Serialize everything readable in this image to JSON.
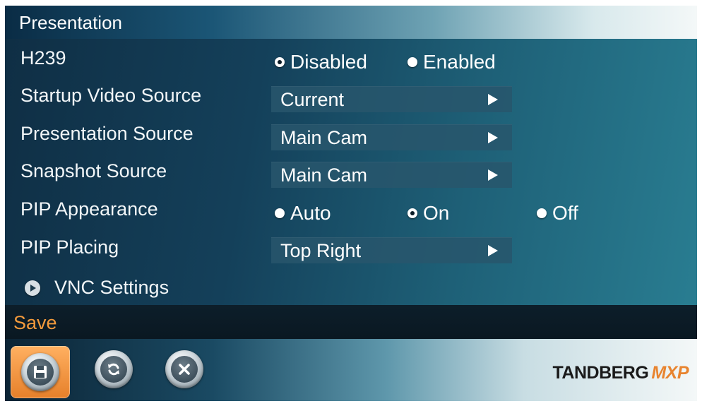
{
  "header": {
    "title": "Presentation"
  },
  "rows": {
    "h239": {
      "label": "H239",
      "options": [
        {
          "label": "Disabled",
          "selected": true
        },
        {
          "label": "Enabled",
          "selected": false
        }
      ]
    },
    "startup_video_source": {
      "label": "Startup Video Source",
      "value": "Current"
    },
    "presentation_source": {
      "label": "Presentation Source",
      "value": "Main Cam"
    },
    "snapshot_source": {
      "label": "Snapshot Source",
      "value": "Main Cam"
    },
    "pip_appearance": {
      "label": "PIP Appearance",
      "options": [
        {
          "label": "Auto",
          "selected": false
        },
        {
          "label": "On",
          "selected": true
        },
        {
          "label": "Off",
          "selected": false
        }
      ]
    },
    "pip_placing": {
      "label": "PIP Placing",
      "value": "Top Right"
    }
  },
  "vnc": {
    "label": "VNC Settings"
  },
  "savebar": {
    "label": "Save"
  },
  "footer": {
    "buttons": [
      {
        "icon": "floppy-disk-icon",
        "active": true
      },
      {
        "icon": "refresh-icon",
        "active": false
      },
      {
        "icon": "close-icon",
        "active": false
      }
    ],
    "brand": {
      "name": "TANDBERG",
      "suffix": "MXP"
    }
  },
  "colors": {
    "accent": "#f39a3c",
    "panel": "#14405a",
    "selectBg": "#28566c"
  }
}
